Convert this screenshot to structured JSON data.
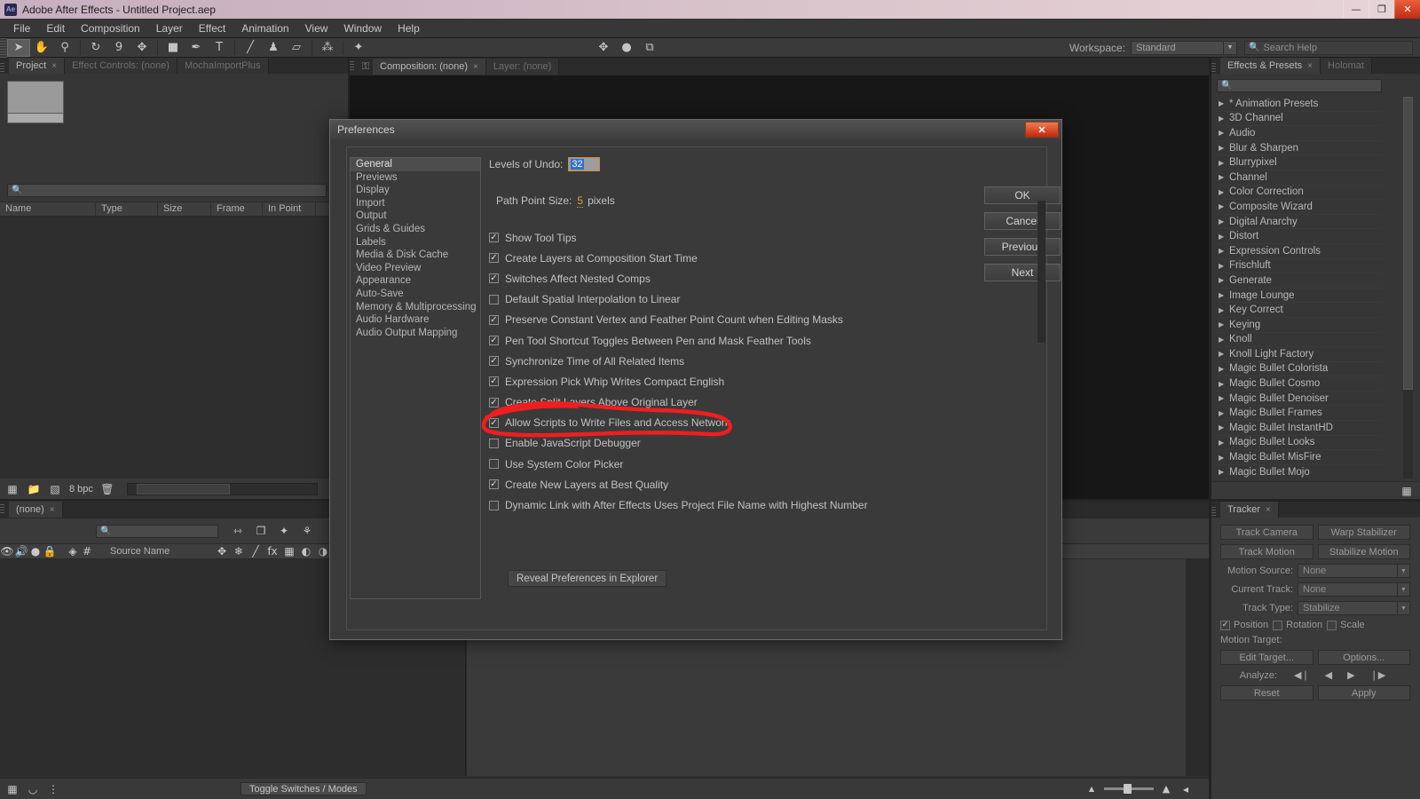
{
  "window": {
    "app_icon": "Ae",
    "title": "Adobe After Effects - Untitled Project.aep",
    "controls": {
      "minimize": "—",
      "maximize": "❐",
      "close": "✕"
    }
  },
  "menubar": {
    "items": [
      "File",
      "Edit",
      "Composition",
      "Layer",
      "Effect",
      "Animation",
      "View",
      "Window",
      "Help"
    ]
  },
  "toolbar": {
    "tools": [
      {
        "name": "selection-tool",
        "glyph": "➤",
        "selected": true
      },
      {
        "name": "hand-tool",
        "glyph": "✋",
        "selected": false
      },
      {
        "name": "zoom-tool",
        "glyph": "⚲",
        "selected": false
      },
      {
        "name": "rotation-tool",
        "glyph": "↻",
        "selected": false
      },
      {
        "name": "camera-tool",
        "glyph": "὏9",
        "selected": false
      },
      {
        "name": "pan-behind-tool",
        "glyph": "✥",
        "selected": false
      },
      {
        "name": "shape-tool",
        "glyph": "■",
        "selected": false
      },
      {
        "name": "pen-tool",
        "glyph": "✒",
        "selected": false
      },
      {
        "name": "type-tool",
        "glyph": "T",
        "selected": false
      },
      {
        "name": "brush-tool",
        "glyph": "╱",
        "selected": false
      },
      {
        "name": "clone-stamp-tool",
        "glyph": "♟",
        "selected": false
      },
      {
        "name": "eraser-tool",
        "glyph": "▱",
        "selected": false
      },
      {
        "name": "roto-brush-tool",
        "glyph": "⁂",
        "selected": false
      },
      {
        "name": "puppet-pin-tool",
        "glyph": "✦",
        "selected": false
      }
    ],
    "right_tools": [
      {
        "name": "move-anchor-icon",
        "glyph": "✥"
      },
      {
        "name": "mask-feather-icon",
        "glyph": "●"
      },
      {
        "name": "snapping-icon",
        "glyph": "⧉"
      }
    ],
    "workspace_label": "Workspace:",
    "workspace_value": "Standard",
    "search_placeholder": "Search Help"
  },
  "project_panel": {
    "tabs": [
      {
        "label": "Project",
        "active": true,
        "closable": true
      },
      {
        "label": "Effect Controls: (none)",
        "active": false,
        "closable": false
      },
      {
        "label": "MochaImportPlus",
        "active": false,
        "closable": false
      }
    ],
    "search_placeholder": "",
    "columns": [
      "Name",
      "Type",
      "Size",
      "Frame R...",
      "In Point"
    ],
    "footer": {
      "bit_depth": "8 bpc",
      "icons": [
        "new-comp-icon",
        "new-folder-icon",
        "project-settings-icon",
        "delete-icon"
      ]
    }
  },
  "comp_panel": {
    "tabs": [
      {
        "label": "Composition: (none)",
        "active": true,
        "closable": true
      },
      {
        "label": "Layer: (none)",
        "active": false,
        "closable": false
      }
    ]
  },
  "effects_panel": {
    "tabs": [
      {
        "label": "Effects & Presets",
        "active": true,
        "closable": true
      },
      {
        "label": "Holomat",
        "active": false,
        "closable": false
      }
    ],
    "search_placeholder": "",
    "categories": [
      "* Animation Presets",
      "3D Channel",
      "Audio",
      "Blur & Sharpen",
      "Blurrypixel",
      "Channel",
      "Color Correction",
      "Composite Wizard",
      "Digital Anarchy",
      "Distort",
      "Expression Controls",
      "Frischluft",
      "Generate",
      "Image Lounge",
      "Key Correct",
      "Keying",
      "Knoll",
      "Knoll Light Factory",
      "Magic Bullet Colorista",
      "Magic Bullet Cosmo",
      "Magic Bullet Denoiser",
      "Magic Bullet Frames",
      "Magic Bullet InstantHD",
      "Magic Bullet Looks",
      "Magic Bullet MisFire",
      "Magic Bullet Mojo"
    ]
  },
  "tracker_panel": {
    "tabs": [
      {
        "label": "Tracker",
        "active": true,
        "closable": true
      }
    ],
    "buttons_row1": [
      "Track Camera",
      "Warp Stabilizer"
    ],
    "buttons_row2": [
      "Track Motion",
      "Stabilize Motion"
    ],
    "fields": [
      {
        "label": "Motion Source:",
        "value": "None"
      },
      {
        "label": "Current Track:",
        "value": "None"
      },
      {
        "label": "Track Type:",
        "value": "Stabilize"
      }
    ],
    "checkboxes": [
      {
        "label": "Position",
        "checked": true
      },
      {
        "label": "Rotation",
        "checked": false
      },
      {
        "label": "Scale",
        "checked": false
      }
    ],
    "motion_target_label": "Motion Target:",
    "edit_target_button": "Edit Target...",
    "options_button": "Options...",
    "analyze_label": "Analyze:",
    "analyze_buttons": [
      "◀❘",
      "◀",
      "▶",
      "❘▶"
    ],
    "reset_button": "Reset",
    "apply_button": "Apply"
  },
  "timeline_panel": {
    "tabs": [
      {
        "label": "(none)",
        "active": true,
        "closable": true
      }
    ],
    "search_placeholder": "",
    "header_columns": [
      "Source Name"
    ],
    "toggle_button": "Toggle Switches / Modes"
  },
  "preferences_dialog": {
    "title": "Preferences",
    "close_glyph": "✕",
    "categories": [
      {
        "label": "General",
        "selected": true
      },
      {
        "label": "Previews",
        "selected": false
      },
      {
        "label": "Display",
        "selected": false
      },
      {
        "label": "Import",
        "selected": false
      },
      {
        "label": "Output",
        "selected": false
      },
      {
        "label": "Grids & Guides",
        "selected": false
      },
      {
        "label": "Labels",
        "selected": false
      },
      {
        "label": "Media & Disk Cache",
        "selected": false
      },
      {
        "label": "Video Preview",
        "selected": false
      },
      {
        "label": "Appearance",
        "selected": false
      },
      {
        "label": "Auto-Save",
        "selected": false
      },
      {
        "label": "Memory & Multiprocessing",
        "selected": false
      },
      {
        "label": "Audio Hardware",
        "selected": false
      },
      {
        "label": "Audio Output Mapping",
        "selected": false
      }
    ],
    "levels_of_undo": {
      "label": "Levels of Undo:",
      "value": "32",
      "selected": true
    },
    "path_point_size": {
      "label": "Path Point Size:",
      "value": "5",
      "unit": "pixels"
    },
    "options": [
      {
        "label": "Show Tool Tips",
        "checked": true,
        "highlighted": false
      },
      {
        "label": "Create Layers at Composition Start Time",
        "checked": true,
        "highlighted": false
      },
      {
        "label": "Switches Affect Nested Comps",
        "checked": true,
        "highlighted": false
      },
      {
        "label": "Default Spatial Interpolation to Linear",
        "checked": false,
        "highlighted": false
      },
      {
        "label": "Preserve Constant Vertex and Feather Point Count when Editing Masks",
        "checked": true,
        "highlighted": false
      },
      {
        "label": "Pen Tool Shortcut Toggles Between Pen and Mask Feather Tools",
        "checked": true,
        "highlighted": false
      },
      {
        "label": "Synchronize Time of All Related Items",
        "checked": true,
        "highlighted": false
      },
      {
        "label": "Expression Pick Whip Writes Compact English",
        "checked": true,
        "highlighted": false
      },
      {
        "label": "Create Split Layers Above Original Layer",
        "checked": true,
        "highlighted": false
      },
      {
        "label": "Allow Scripts to Write Files and Access Network",
        "checked": true,
        "highlighted": true
      },
      {
        "label": "Enable JavaScript Debugger",
        "checked": false,
        "highlighted": false
      },
      {
        "label": "Use System Color Picker",
        "checked": false,
        "highlighted": false
      },
      {
        "label": "Create New Layers at Best Quality",
        "checked": true,
        "highlighted": false
      },
      {
        "label": "Dynamic Link with After Effects Uses Project File Name with Highest Number",
        "checked": false,
        "highlighted": false
      }
    ],
    "reveal_button": "Reveal Preferences in Explorer",
    "action_buttons": [
      {
        "label": "OK"
      },
      {
        "label": "Cancel"
      },
      {
        "label": "Previous"
      },
      {
        "label": "Next"
      }
    ]
  },
  "annotation": {
    "color": "#f01e1e",
    "target": "Allow Scripts to Write Files and Access Network",
    "shape": "hand-drawn-red-circle"
  }
}
